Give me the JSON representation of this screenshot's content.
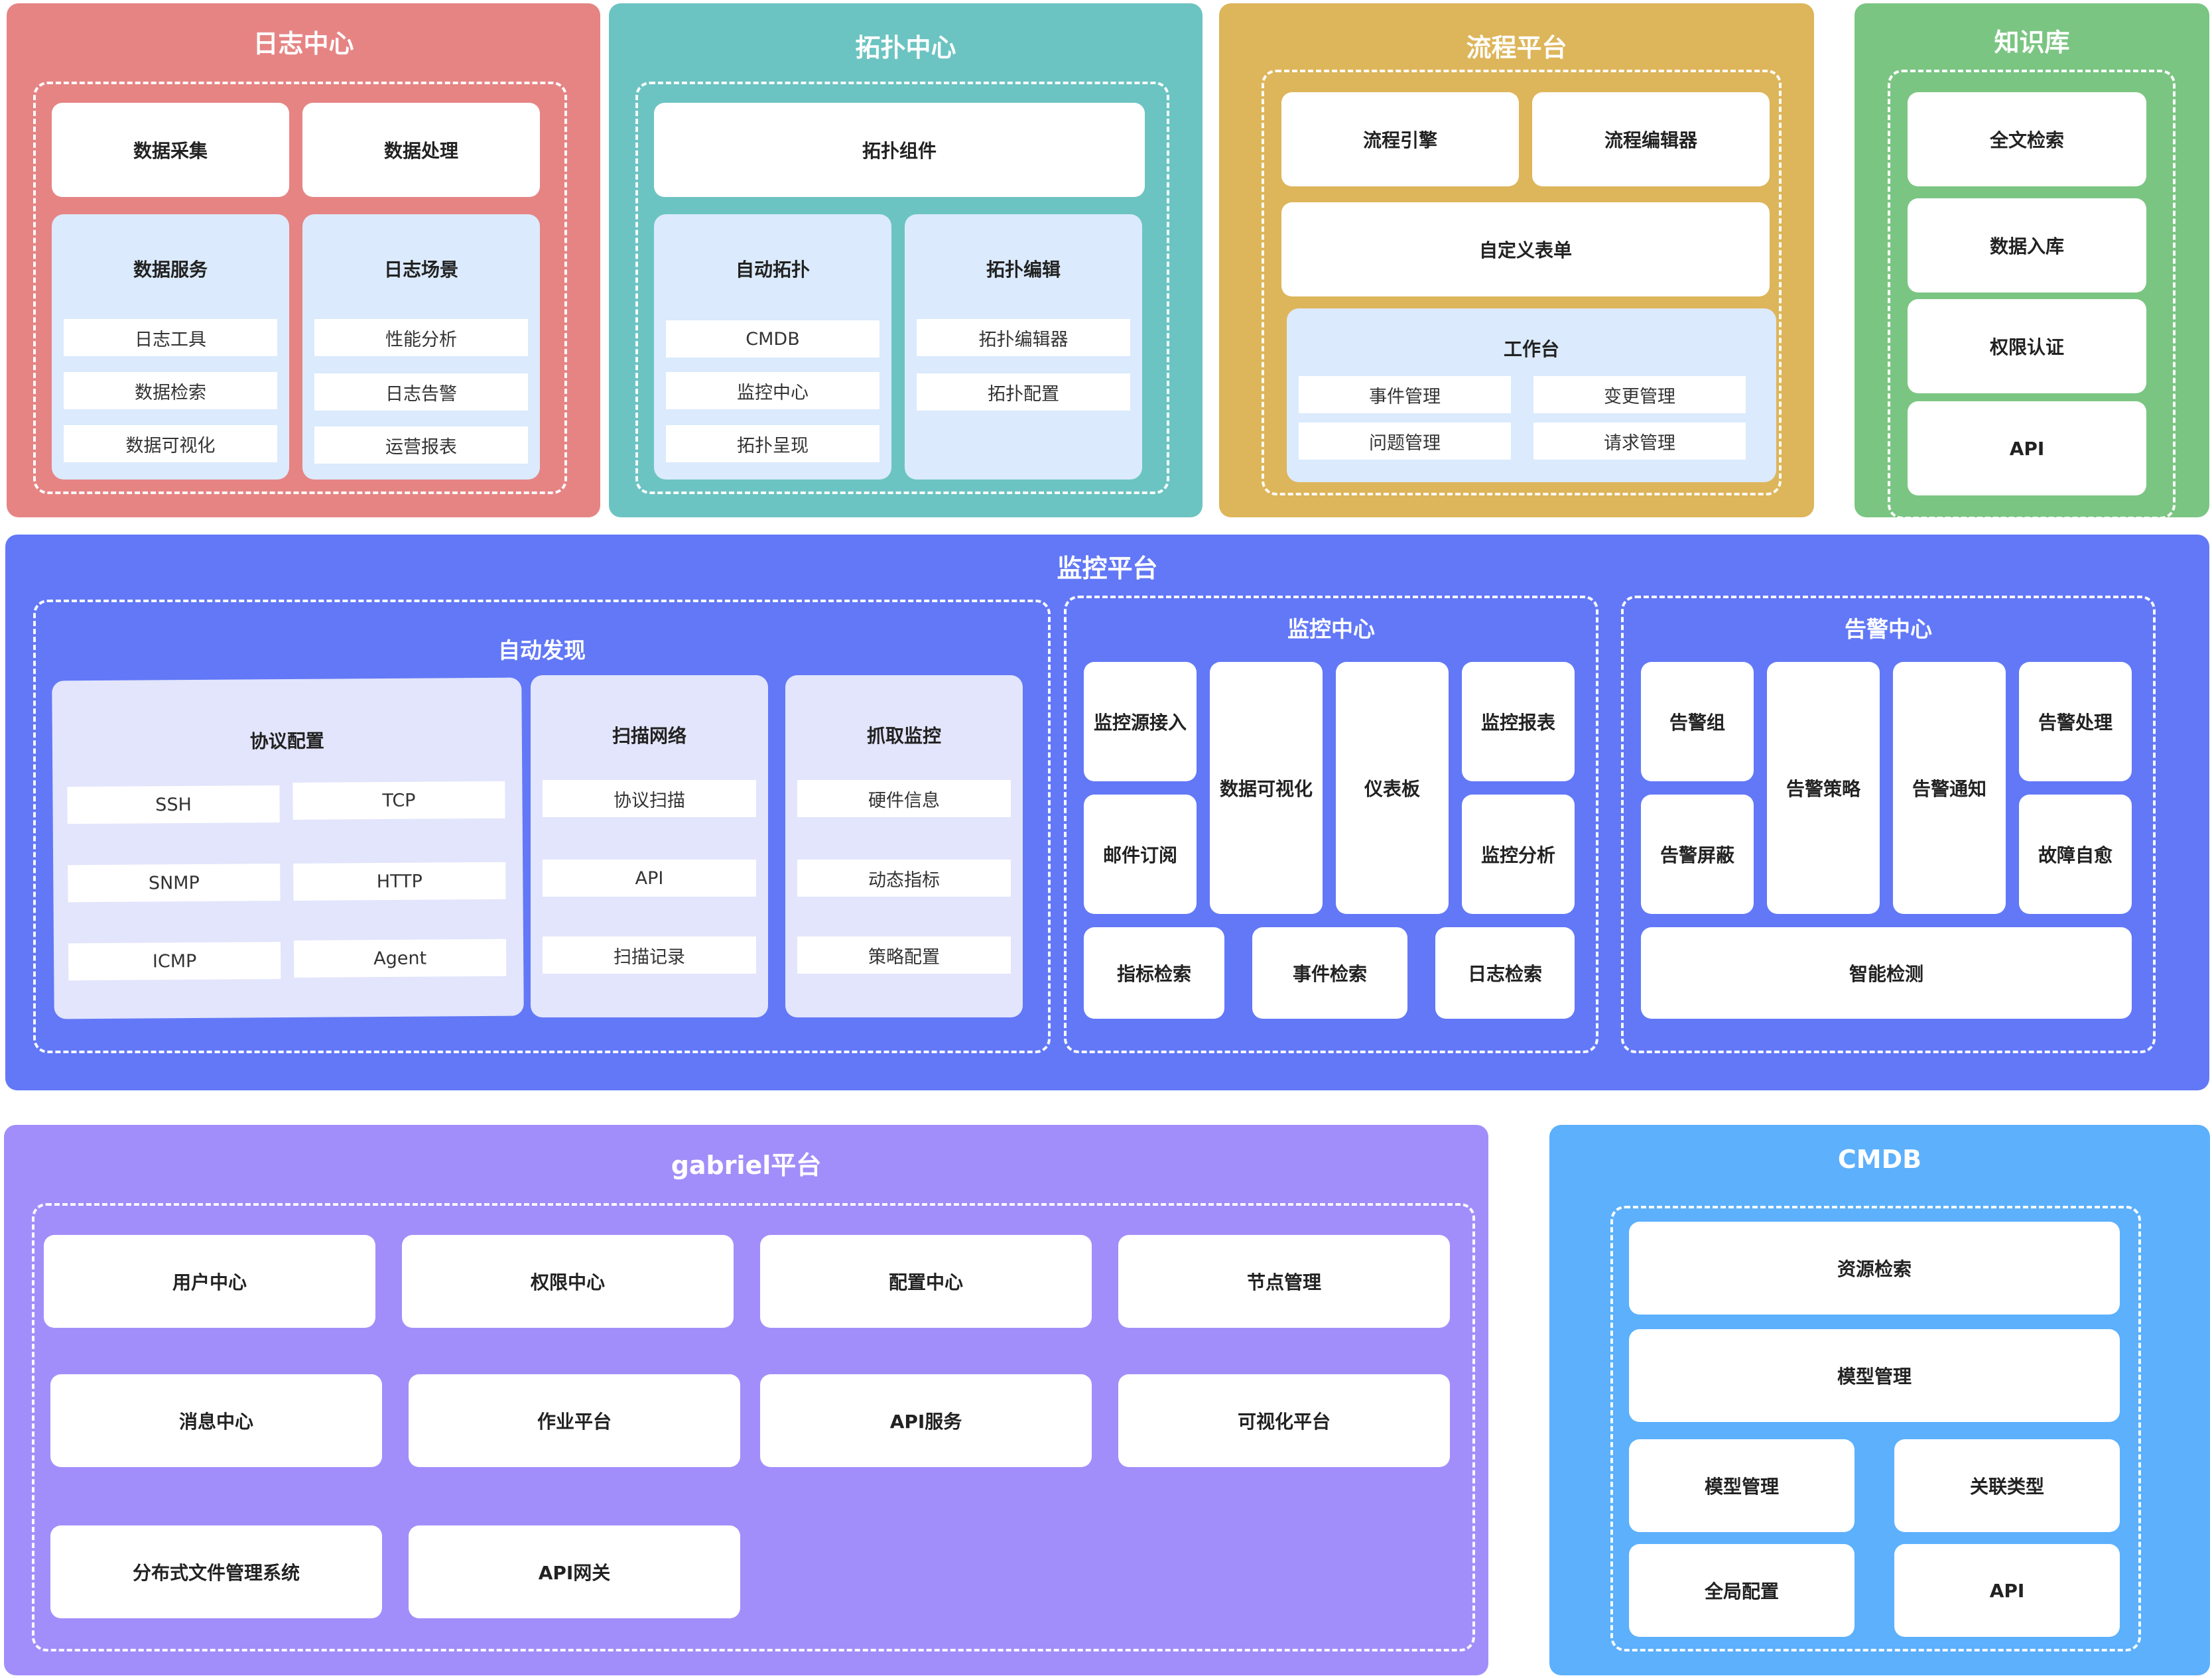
{
  "colors": {
    "log": "#e68484",
    "topo": "#6cc4c2",
    "flow": "#ddb55a",
    "kb": "#7bc582",
    "monitor": "#6278f7",
    "gabriel": "#a28efa",
    "cmdb": "#5cb0fc",
    "light_blue": "#dbeafc",
    "light_indigo": "#e2e5fb"
  },
  "log": {
    "title": "日志中心",
    "collect": "数据采集",
    "process": "数据处理",
    "service": {
      "title": "数据服务",
      "items": [
        "日志工具",
        "数据检索",
        "数据可视化"
      ]
    },
    "scene": {
      "title": "日志场景",
      "items": [
        "性能分析",
        "日志告警",
        "运营报表"
      ]
    }
  },
  "topo": {
    "title": "拓扑中心",
    "component": "拓扑组件",
    "auto": {
      "title": "自动拓扑",
      "items": [
        "CMDB",
        "监控中心",
        "拓扑呈现"
      ]
    },
    "edit": {
      "title": "拓扑编辑",
      "items": [
        "拓扑编辑器",
        "拓扑配置"
      ]
    }
  },
  "flow": {
    "title": "流程平台",
    "engine": "流程引擎",
    "editor": "流程编辑器",
    "form": "自定义表单",
    "workbench": {
      "title": "工作台",
      "items": [
        "事件管理",
        "变更管理",
        "问题管理",
        "请求管理"
      ]
    }
  },
  "kb": {
    "title": "知识库",
    "items": [
      "全文检索",
      "数据入库",
      "权限认证",
      "API"
    ]
  },
  "monitor": {
    "title": "监控平台",
    "discovery": {
      "title": "自动发现",
      "protocol": {
        "title": "协议配置",
        "items": [
          "SSH",
          "TCP",
          "SNMP",
          "HTTP",
          "ICMP",
          "Agent"
        ]
      },
      "scan": {
        "title": "扫描网络",
        "items": [
          "协议扫描",
          "API",
          "扫描记录"
        ]
      },
      "fetch": {
        "title": "抓取监控",
        "items": [
          "硬件信息",
          "动态指标",
          "策略配置"
        ]
      }
    },
    "center": {
      "title": "监控中心",
      "source": "监控源接入",
      "mail": "邮件订阅",
      "visual": "数据可视化",
      "dashboard": "仪表板",
      "report": "监控报表",
      "analysis": "监控分析",
      "metric_search": "指标检索",
      "event_search": "事件检索",
      "log_search": "日志检索"
    },
    "alert": {
      "title": "告警中心",
      "group": "告警组",
      "shield": "告警屏蔽",
      "policy": "告警策略",
      "notify": "告警通知",
      "handle": "告警处理",
      "heal": "故障自愈",
      "detect": "智能检测"
    }
  },
  "gabriel": {
    "title": "gabriel平台",
    "items": [
      "用户中心",
      "权限中心",
      "配置中心",
      "节点管理",
      "消息中心",
      "作业平台",
      "API服务",
      "可视化平台",
      "分布式文件管理系统",
      "API网关"
    ]
  },
  "cmdb": {
    "title": "CMDB",
    "search": "资源检索",
    "model": "模型管理",
    "model2": "模型管理",
    "relation": "关联类型",
    "global": "全局配置",
    "api": "API"
  }
}
